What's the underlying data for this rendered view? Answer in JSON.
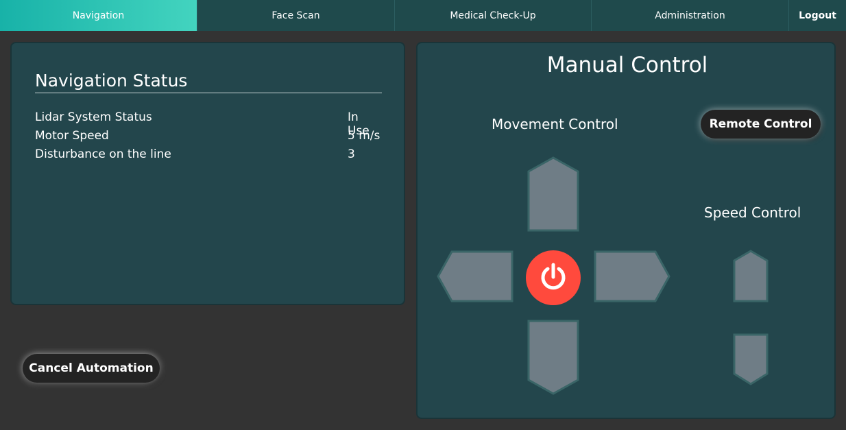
{
  "nav": {
    "tabs": [
      {
        "label": "Navigation",
        "active": true
      },
      {
        "label": "Face Scan",
        "active": false
      },
      {
        "label": "Medical Check-Up",
        "active": false
      },
      {
        "label": "Administration",
        "active": false
      }
    ],
    "logout_label": "Logout"
  },
  "status": {
    "title": "Navigation Status",
    "rows": [
      {
        "label": "Lidar System Status",
        "value": "In Use"
      },
      {
        "label": "Motor Speed",
        "value": "5 m/s"
      },
      {
        "label": "Disturbance on the line",
        "value": "3"
      }
    ]
  },
  "actions": {
    "cancel_label": "Cancel Automation"
  },
  "manual": {
    "title": "Manual Control",
    "movement_title": "Movement Control",
    "remote_label": "Remote Control",
    "speed_title": "Speed Control",
    "icons": {
      "up": "arrow-up-icon",
      "down": "arrow-down-icon",
      "left": "arrow-left-icon",
      "right": "arrow-right-icon",
      "power": "power-icon",
      "speed_up": "speed-up-icon",
      "speed_down": "speed-down-icon"
    }
  },
  "colors": {
    "background": "#333333",
    "panel": "#23464c",
    "topbar": "#1f4a4c",
    "active_tab_start": "#18b2a8",
    "active_tab_end": "#43d4bf",
    "arrow_fill": "#6f7d86",
    "power_button": "#ff4a3d",
    "pill_button": "#232323"
  }
}
